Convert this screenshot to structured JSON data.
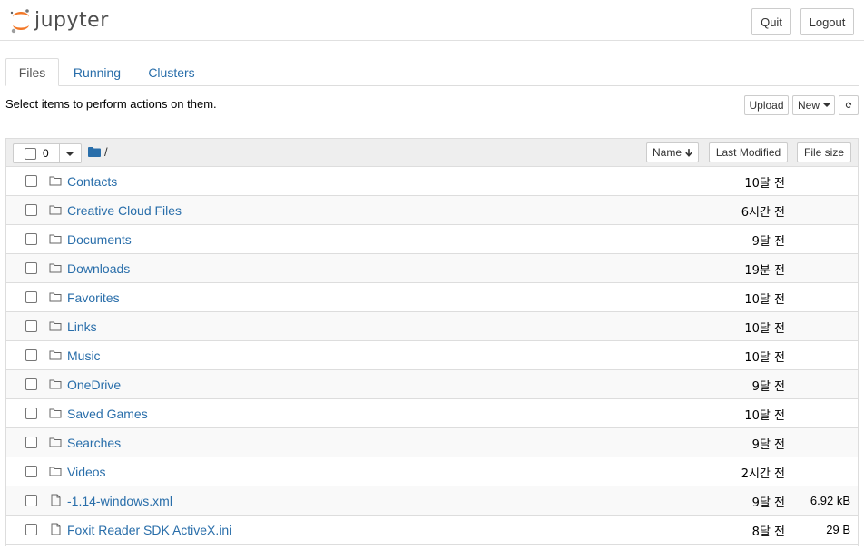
{
  "header": {
    "brand": "jupyter",
    "quit_label": "Quit",
    "logout_label": "Logout"
  },
  "tabs": [
    {
      "label": "Files",
      "active": true
    },
    {
      "label": "Running",
      "active": false
    },
    {
      "label": "Clusters",
      "active": false
    }
  ],
  "toolbar": {
    "hint": "Select items to perform actions on them.",
    "upload_label": "Upload",
    "new_label": "New"
  },
  "list_header": {
    "selected_count": "0",
    "breadcrumb": "/",
    "sort_name_label": "Name",
    "last_modified_label": "Last Modified",
    "file_size_label": "File size"
  },
  "items": [
    {
      "type": "folder",
      "name": "Contacts",
      "modified": "10달 전",
      "size": ""
    },
    {
      "type": "folder",
      "name": "Creative Cloud Files",
      "modified": "6시간 전",
      "size": ""
    },
    {
      "type": "folder",
      "name": "Documents",
      "modified": "9달 전",
      "size": ""
    },
    {
      "type": "folder",
      "name": "Downloads",
      "modified": "19분 전",
      "size": ""
    },
    {
      "type": "folder",
      "name": "Favorites",
      "modified": "10달 전",
      "size": ""
    },
    {
      "type": "folder",
      "name": "Links",
      "modified": "10달 전",
      "size": ""
    },
    {
      "type": "folder",
      "name": "Music",
      "modified": "10달 전",
      "size": ""
    },
    {
      "type": "folder",
      "name": "OneDrive",
      "modified": "9달 전",
      "size": ""
    },
    {
      "type": "folder",
      "name": "Saved Games",
      "modified": "10달 전",
      "size": ""
    },
    {
      "type": "folder",
      "name": "Searches",
      "modified": "9달 전",
      "size": ""
    },
    {
      "type": "folder",
      "name": "Videos",
      "modified": "2시간 전",
      "size": ""
    },
    {
      "type": "file",
      "name": "-1.14-windows.xml",
      "modified": "9달 전",
      "size": "6.92 kB"
    },
    {
      "type": "file",
      "name": "Foxit Reader SDK ActiveX.ini",
      "modified": "8달 전",
      "size": "29 B"
    }
  ],
  "colors": {
    "link": "#296eaa",
    "brand_orange": "#f37726",
    "folder_icon": "#296eaa"
  }
}
